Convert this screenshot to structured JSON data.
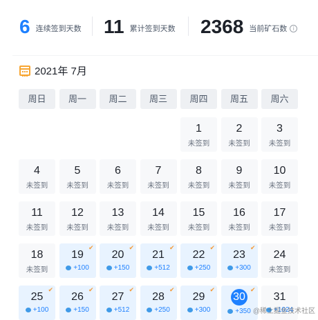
{
  "stats": {
    "streak_value": "6",
    "streak_label": "连续签到天数",
    "total_value": "11",
    "total_label": "累计签到天数",
    "ore_value": "2368",
    "ore_label": "当前矿石数",
    "info_icon": "i"
  },
  "calendar": {
    "month_label": "2021年 7月",
    "weekdays": [
      "周日",
      "周一",
      "周二",
      "周三",
      "周四",
      "周五",
      "周六"
    ],
    "unchecked_label": "未签到",
    "days": [
      {
        "day": "1",
        "status": "未签到"
      },
      {
        "day": "2",
        "status": "未签到"
      },
      {
        "day": "3",
        "status": "未签到"
      },
      {
        "day": "4",
        "status": "未签到"
      },
      {
        "day": "5",
        "status": "未签到"
      },
      {
        "day": "6",
        "status": "未签到"
      },
      {
        "day": "7",
        "status": "未签到"
      },
      {
        "day": "8",
        "status": "未签到"
      },
      {
        "day": "9",
        "status": "未签到"
      },
      {
        "day": "10",
        "status": "未签到"
      },
      {
        "day": "11",
        "status": "未签到"
      },
      {
        "day": "12",
        "status": "未签到"
      },
      {
        "day": "13",
        "status": "未签到"
      },
      {
        "day": "14",
        "status": "未签到"
      },
      {
        "day": "15",
        "status": "未签到"
      },
      {
        "day": "16",
        "status": "未签到"
      },
      {
        "day": "17",
        "status": "未签到"
      },
      {
        "day": "18",
        "status": "未签到"
      },
      {
        "day": "19",
        "points": "+100",
        "checked": true
      },
      {
        "day": "20",
        "points": "+150",
        "checked": true
      },
      {
        "day": "21",
        "points": "+512",
        "checked": true
      },
      {
        "day": "22",
        "points": "+250",
        "checked": true
      },
      {
        "day": "23",
        "points": "+300",
        "checked": true
      },
      {
        "day": "24",
        "status": "未签到"
      },
      {
        "day": "25",
        "points": "+100",
        "checked": true
      },
      {
        "day": "26",
        "points": "+150",
        "checked": true
      },
      {
        "day": "27",
        "points": "+512",
        "checked": true
      },
      {
        "day": "28",
        "points": "+250",
        "checked": true
      },
      {
        "day": "29",
        "points": "+300",
        "checked": true
      },
      {
        "day": "30",
        "points": "+350",
        "checked": true,
        "today": true
      },
      {
        "day": "31",
        "points": "+1024"
      }
    ],
    "first_weekday_index": 4
  },
  "colors": {
    "accent": "#1e80ff",
    "checkmark": "#f39a3a",
    "calendar_icon": "#f7a531"
  },
  "watermark": "@稀土掘金技术社区"
}
